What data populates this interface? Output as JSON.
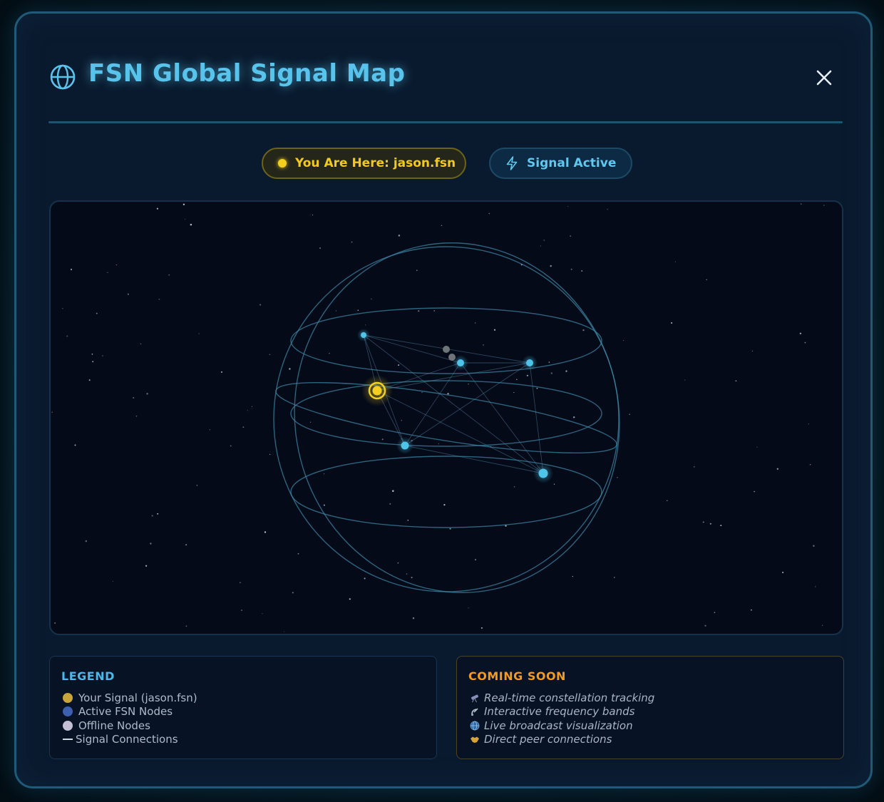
{
  "header": {
    "title": "FSN Global Signal Map",
    "icon": "globe-icon",
    "close_icon": "close-icon"
  },
  "status": {
    "location_label": "You Are Here: jason.fsn",
    "signal_label": "Signal Active",
    "signal_icon": "lightning-icon"
  },
  "legend": {
    "title": "LEGEND",
    "items": [
      {
        "label": "Your Signal (jason.fsn)",
        "color": "#c9a43a"
      },
      {
        "label": "Active FSN Nodes",
        "color": "#3d5fb0"
      },
      {
        "label": "Offline Nodes",
        "color": "#c5bfd4"
      },
      {
        "label": "Signal Connections",
        "color": "#d0d8e0"
      }
    ]
  },
  "coming_soon": {
    "title": "COMING SOON",
    "items": [
      {
        "label": "Real-time constellation tracking",
        "icon": "telescope-icon"
      },
      {
        "label": "Interactive frequency bands",
        "icon": "satellite-icon"
      },
      {
        "label": "Live broadcast visualization",
        "icon": "globe-icon"
      },
      {
        "label": "Direct peer connections",
        "icon": "handshake-icon"
      }
    ]
  },
  "colors": {
    "accent": "#58c4ec",
    "user_signal": "#f5cf1f",
    "active_node": "#4fc3e8",
    "offline_node": "#6a6a6a",
    "coming_soon": "#f59a1c"
  }
}
